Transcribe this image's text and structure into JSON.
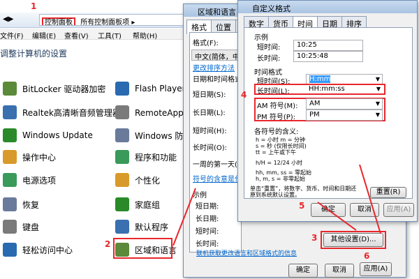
{
  "cp": {
    "addr_parts": [
      "控制面板",
      "所有控制面板项"
    ],
    "menu": [
      "文件(F)",
      "编辑(E)",
      "查看(V)",
      "工具(T)",
      "帮助(H)"
    ],
    "title": "调整计算机的设置",
    "items_left": [
      "BitLocker 驱动器加密",
      "Realtek高清晰音频管理器",
      "Windows Update",
      "操作中心",
      "电源选项",
      "恢复",
      "键盘",
      "轻松访问中心"
    ],
    "items_right": [
      "Flash Player (32",
      "RemoteApp 和",
      "Windows 防火",
      "程序和功能",
      "个性化",
      "家庭组",
      "默认程序",
      "区域和语言"
    ]
  },
  "region": {
    "title": "区域和语言",
    "tabs": [
      "格式",
      "位置",
      "键"
    ],
    "format_label": "格式(F):",
    "format_value": "中文(简体，中国)",
    "sort_link": "更改排序方法",
    "dt_group": "日期和时间格式",
    "rows": [
      "短日期(S):",
      "长日期(L):",
      "短时间(H):",
      "长时间(O):",
      "一周的第一天(W):"
    ],
    "symbol_link": "符号的含意是什么?",
    "example": "示例",
    "ex_rows": [
      "短日期:",
      "长日期:",
      "短时间:",
      "长时间:"
    ],
    "online_link": "联机获取更改语言和区域格式的信息",
    "ok": "确定",
    "cancel": "取消",
    "apply": "应用(A)"
  },
  "custom": {
    "title": "自定义格式",
    "tabs": [
      "数字",
      "货币",
      "时间",
      "日期",
      "排序"
    ],
    "example": "示例",
    "short_time_l": "短时间:",
    "short_time_v": "10:25",
    "long_time_l": "长时间:",
    "long_time_v": "10:25:48",
    "tf": "时间格式",
    "st_l": "短时间(S):",
    "st_v": "H:mm",
    "lt_l": "长时间(L):",
    "lt_v": "HH:mm:ss",
    "am_l": "AM 符号(M):",
    "am_v": "AM",
    "pm_l": "PM 符号(P):",
    "pm_v": "PM",
    "legend_title": "各符号的含义:",
    "legend": [
      "h = 小时    m = 分钟",
      "s = 秒 (仅限长时间)",
      "tt = 上午或下午",
      "h/H = 12/24 小时",
      "hh, mm, ss = 零起始",
      "h, m, s = 非零起始"
    ],
    "reset_text": "单击“重置”，将数字、货币、时间和日期还原到系统默认设置。",
    "reset": "重置(R)",
    "ok": "确定",
    "cancel": "取消",
    "apply": "应用(A)",
    "other": "其他设置(D)..."
  },
  "nums": [
    "1",
    "2",
    "3",
    "4",
    "5",
    "6"
  ]
}
